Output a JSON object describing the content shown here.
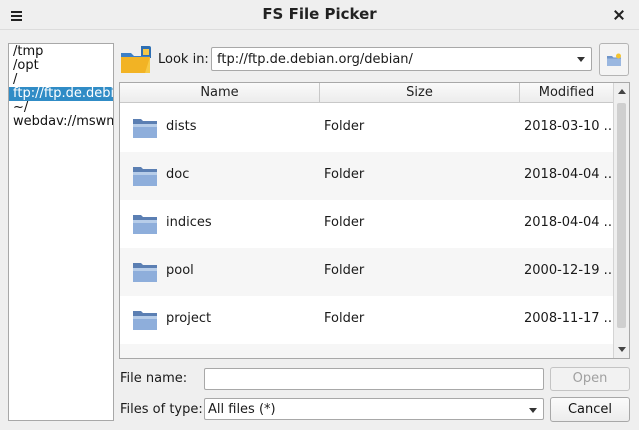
{
  "window": {
    "title": "FS File Picker"
  },
  "places": [
    {
      "label": "/tmp",
      "selected": false
    },
    {
      "label": "/opt",
      "selected": false
    },
    {
      "label": "/",
      "selected": false
    },
    {
      "label": "ftp://ftp.de.debian.org/debian/",
      "selected": true
    },
    {
      "label": "~/",
      "selected": false
    },
    {
      "label": "webdav://mswms",
      "selected": false
    }
  ],
  "lookin": {
    "label": "Look in:",
    "value": "ftp://ftp.de.debian.org/debian/"
  },
  "columns": {
    "name": "Name",
    "size": "Size",
    "modified": "Modified"
  },
  "files": [
    {
      "name": "dists",
      "size": "Folder",
      "modified": "2018-03-10 ..."
    },
    {
      "name": "doc",
      "size": "Folder",
      "modified": "2018-04-04 ..."
    },
    {
      "name": "indices",
      "size": "Folder",
      "modified": "2018-04-04 ..."
    },
    {
      "name": "pool",
      "size": "Folder",
      "modified": "2000-12-19 ..."
    },
    {
      "name": "project",
      "size": "Folder",
      "modified": "2008-11-17 ..."
    }
  ],
  "filename": {
    "label": "File name:",
    "value": "",
    "open_label": "Open"
  },
  "filetype": {
    "label": "Files of type:",
    "value": "All files (*)",
    "cancel_label": "Cancel"
  },
  "colors": {
    "selection": "#308cc6",
    "folder": "#5b7fb3"
  }
}
